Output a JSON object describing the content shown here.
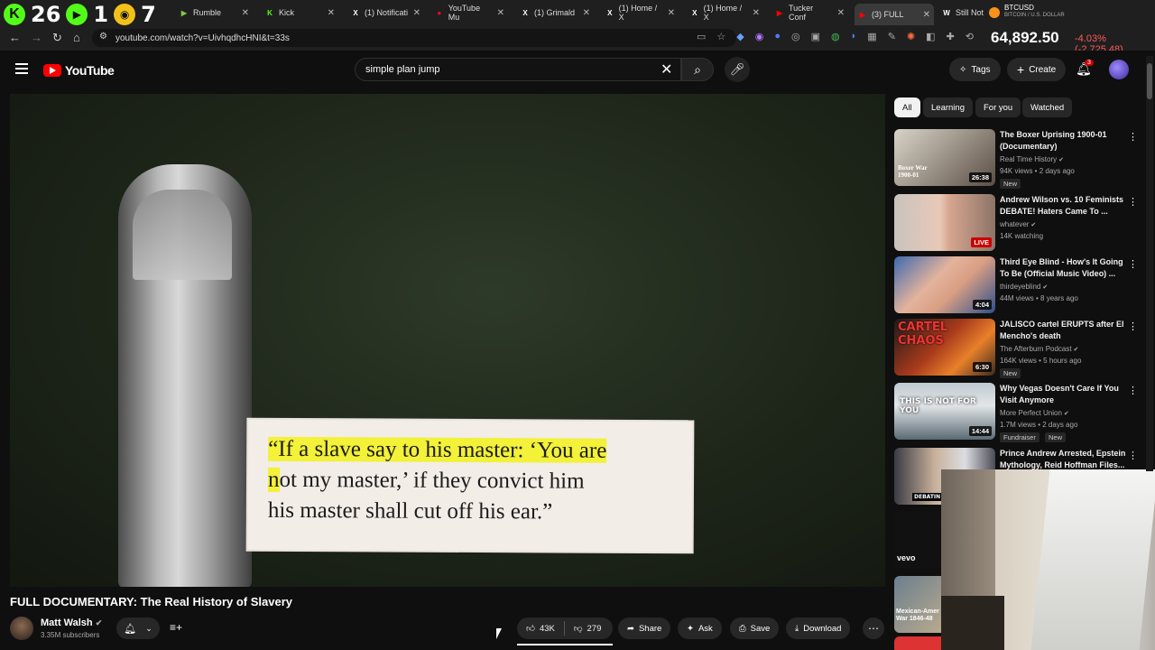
{
  "browser": {
    "overlay": {
      "k": "K",
      "n1": "26",
      "n2": "1",
      "n3": "7"
    },
    "tabs": [
      {
        "label": "Rumble",
        "fav": "▶",
        "fav_color": "#85c742"
      },
      {
        "label": "Kick",
        "fav": "K",
        "fav_color": "#53fc18"
      },
      {
        "label": "(1) Notificati",
        "fav": "X",
        "fav_color": "#ffffff"
      },
      {
        "label": "YouTube Mu",
        "fav": "●",
        "fav_color": "#ff0033"
      },
      {
        "label": "(1) Grimald",
        "fav": "X",
        "fav_color": "#ffffff"
      },
      {
        "label": "(1) Home / X",
        "fav": "X",
        "fav_color": "#ffffff"
      },
      {
        "label": "(1) Home / X",
        "fav": "X",
        "fav_color": "#ffffff"
      },
      {
        "label": "Tucker Conf",
        "fav": "▶",
        "fav_color": "#ff0000"
      },
      {
        "label": "(3) FULL",
        "fav": "▶",
        "fav_color": "#ff0000"
      },
      {
        "label": "Still Not",
        "fav": "W",
        "fav_color": "#ffffff"
      }
    ],
    "url": "youtube.com/watch?v=UivhqdhcHNI&t=33s",
    "btc": {
      "symbol": "BTCUSD",
      "sub": "BITCOIN / U.S. DOLLAR",
      "price": "64,892.50",
      "change": "-4.03% (-2,725.48)"
    }
  },
  "header": {
    "logo": "YouTube",
    "search_query": "simple plan jump",
    "tags_label": "Tags",
    "create_label": "Create",
    "notif_count": "3"
  },
  "video": {
    "quote_line1_hl": "“If a slave say to his master: ‘You are",
    "quote_line2_hl": "n",
    "quote_line2": "ot my master,’ if they convict him",
    "quote_line3": "his master shall cut off his ear.”",
    "title": "FULL DOCUMENTARY: The Real History of Slavery",
    "channel": "Matt Walsh",
    "subscribers": "3.35M subscribers",
    "likes": "43K",
    "dislikes": "279",
    "share": "Share",
    "ask": "Ask",
    "save": "Save",
    "download": "Download"
  },
  "sidebar": {
    "chips": [
      "All",
      "Learning",
      "For you",
      "Watched"
    ],
    "recs": [
      {
        "title": "The Boxer Uprising 1900-01 (Documentary)",
        "channel": "Real Time History",
        "views": "94K views • 2 days ago",
        "badge": "New",
        "duration": "26:38",
        "thumb_text": "Boxer War 1900-01"
      },
      {
        "title": "Andrew Wilson vs. 10 Feminists DEBATE! Haters Came To ...",
        "channel": "whatever",
        "views": "14K watching",
        "badge": "",
        "duration": "LIVE",
        "thumb_text": ""
      },
      {
        "title": "Third Eye Blind - How's It Going To Be (Official Music Video) ...",
        "channel": "thirdeyeblind",
        "views": "44M views • 8 years ago",
        "badge": "",
        "duration": "4:04",
        "thumb_text": ""
      },
      {
        "title": "JALISCO cartel ERUPTS after El Mencho's death",
        "channel": "The Afterburn Podcast",
        "views": "164K views • 5 hours ago",
        "badge": "New",
        "duration": "6:30",
        "thumb_text": "CARTEL CHAOS"
      },
      {
        "title": "Why Vegas Doesn't Care If You Visit Anymore",
        "channel": "More Perfect Union",
        "views": "1.7M views • 2 days ago",
        "badge": "Fundraiser",
        "badge2": "New",
        "duration": "14:44",
        "thumb_text": "THIS IS NOT FOR YOU"
      },
      {
        "title": "Prince Andrew Arrested, Epstein Mythology, Reid Hoffman Files...",
        "channel": "",
        "views": "",
        "badge": "",
        "duration": "",
        "thumb_text": "DEBATIN MYTH"
      }
    ],
    "extra_thumbs": [
      "vevo",
      "Mexican-Amer War 1846-48"
    ]
  }
}
